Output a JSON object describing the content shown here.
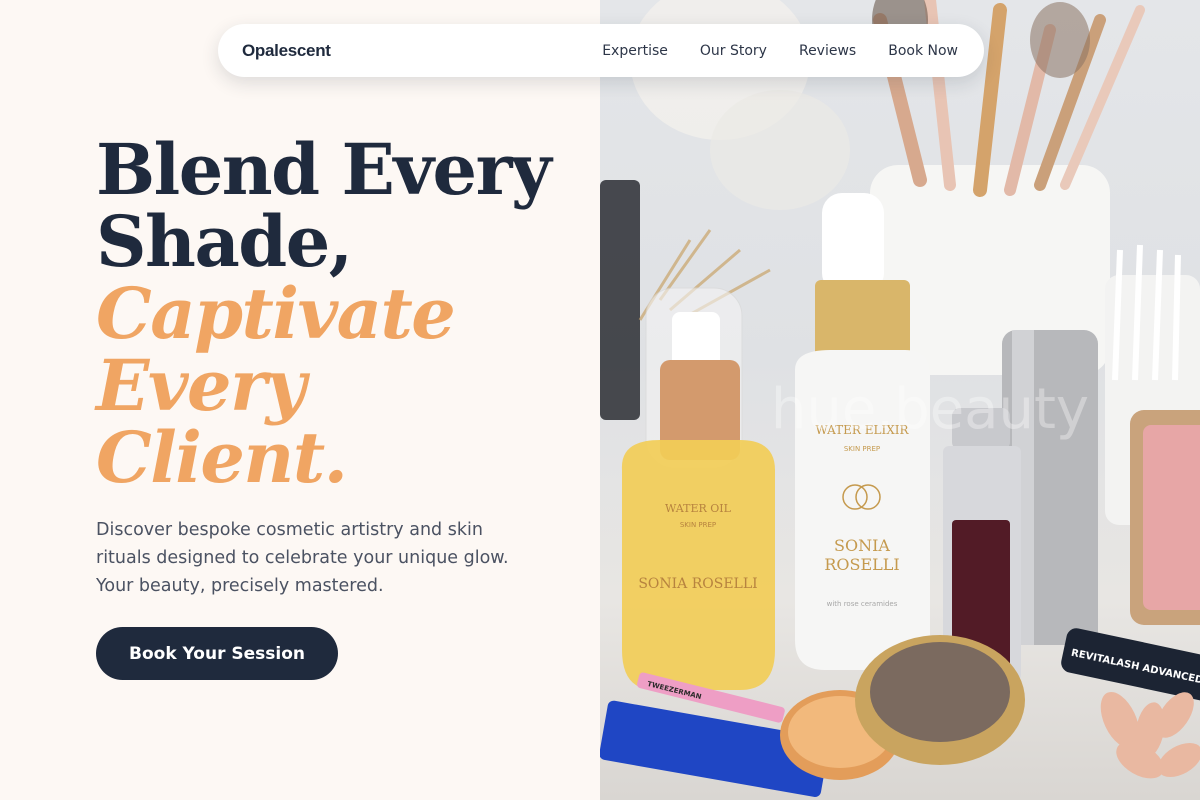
{
  "brand": {
    "name": "Opalescent"
  },
  "nav": {
    "links": [
      "Expertise",
      "Our Story",
      "Reviews",
      "Book Now"
    ]
  },
  "hero": {
    "headline_dark_1": "Blend Every",
    "headline_dark_2": "Shade,",
    "headline_accent_1": "Captivate",
    "headline_accent_2": "Every",
    "headline_accent_3": "Client.",
    "subtext": "Discover bespoke cosmetic artistry and skin rituals designed to celebrate your unique glow. Your beauty, precisely mastered.",
    "cta_label": "Book Your Session"
  },
  "photo": {
    "watermark": "hue.beauty",
    "bottle_left": {
      "line1": "WATER OIL",
      "line2": "SKIN PREP",
      "line3": "SONIA ROSELLI"
    },
    "bottle_center": {
      "line1": "WATER ELIXIR",
      "line2": "SKIN PREP",
      "line3": "SONIA",
      "line4": "ROSELLI",
      "line5": "with rose ceramides"
    },
    "serum_label": "REVITALASH ADVANCED",
    "tweezer_label": "TWEEZERMAN"
  },
  "colors": {
    "navy": "#1f2a3d",
    "accent": "#f0a563",
    "background": "#fdf8f4"
  }
}
